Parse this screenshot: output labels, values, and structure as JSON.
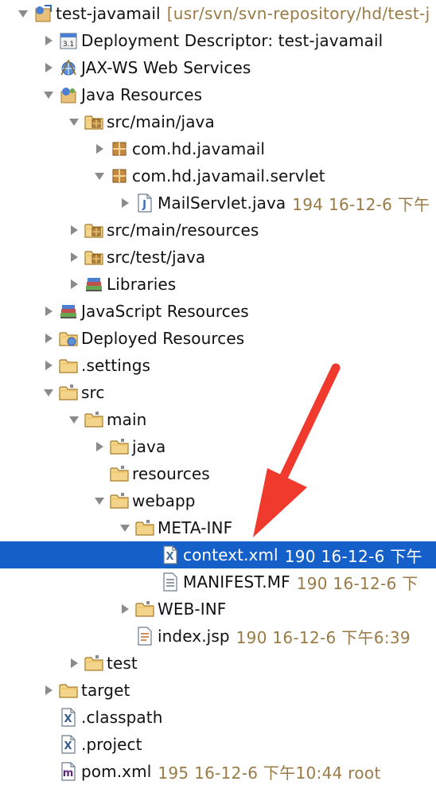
{
  "selected_color": "#1560c8",
  "decoration_color": "#9a7a45",
  "annotation_color": "#f03a2e",
  "tree": [
    {
      "label": "test-javamail",
      "deco": "[usr/svn/svn-repository/hd/test-j",
      "depth": 0,
      "toggle": "expanded",
      "icon": "project-icon"
    },
    {
      "label": "Deployment Descriptor: test-javamail",
      "depth": 1,
      "toggle": "collapsed",
      "icon": "deployment-descriptor-icon"
    },
    {
      "label": "JAX-WS Web Services",
      "depth": 1,
      "toggle": "collapsed",
      "icon": "web-services-icon"
    },
    {
      "label": "Java Resources",
      "depth": 1,
      "toggle": "expanded",
      "icon": "java-resources-icon"
    },
    {
      "label": "src/main/java",
      "depth": 2,
      "toggle": "expanded",
      "icon": "source-folder-icon"
    },
    {
      "label": "com.hd.javamail",
      "depth": 3,
      "toggle": "collapsed",
      "icon": "package-icon"
    },
    {
      "label": "com.hd.javamail.servlet",
      "depth": 3,
      "toggle": "expanded",
      "icon": "package-icon"
    },
    {
      "label": "MailServlet.java",
      "deco": "194  16-12-6 下午",
      "depth": 4,
      "toggle": "collapsed",
      "icon": "java-file-icon"
    },
    {
      "label": "src/main/resources",
      "depth": 2,
      "toggle": "collapsed",
      "icon": "source-folder-icon"
    },
    {
      "label": "src/test/java",
      "depth": 2,
      "toggle": "collapsed",
      "icon": "source-folder-icon"
    },
    {
      "label": "Libraries",
      "depth": 2,
      "toggle": "collapsed",
      "icon": "libraries-icon"
    },
    {
      "label": "JavaScript Resources",
      "depth": 1,
      "toggle": "collapsed",
      "icon": "libraries-icon"
    },
    {
      "label": "Deployed Resources",
      "depth": 1,
      "toggle": "collapsed",
      "icon": "deployed-folder-icon"
    },
    {
      "label": ".settings",
      "depth": 1,
      "toggle": "collapsed",
      "icon": "folder-icon"
    },
    {
      "label": "src",
      "depth": 1,
      "toggle": "expanded",
      "icon": "svn-folder-icon"
    },
    {
      "label": "main",
      "depth": 2,
      "toggle": "expanded",
      "icon": "svn-folder-icon"
    },
    {
      "label": "java",
      "depth": 3,
      "toggle": "collapsed",
      "icon": "svn-folder-icon"
    },
    {
      "label": "resources",
      "depth": 3,
      "toggle": "none",
      "icon": "svn-folder-icon"
    },
    {
      "label": "webapp",
      "depth": 3,
      "toggle": "expanded",
      "icon": "svn-folder-icon"
    },
    {
      "label": "META-INF",
      "depth": 4,
      "toggle": "expanded",
      "icon": "svn-folder-icon"
    },
    {
      "label": "context.xml",
      "deco": "190  16-12-6 下午",
      "depth": 5,
      "toggle": "none",
      "icon": "xml-file-icon",
      "selected": true
    },
    {
      "label": "MANIFEST.MF",
      "deco": "190  16-12-6 下",
      "depth": 5,
      "toggle": "none",
      "icon": "text-file-icon"
    },
    {
      "label": "WEB-INF",
      "depth": 4,
      "toggle": "collapsed",
      "icon": "svn-folder-icon"
    },
    {
      "label": "index.jsp",
      "deco": "190  16-12-6 下午6:39",
      "depth": 4,
      "toggle": "none",
      "icon": "jsp-file-icon"
    },
    {
      "label": "test",
      "depth": 2,
      "toggle": "collapsed",
      "icon": "svn-folder-icon"
    },
    {
      "label": "target",
      "depth": 1,
      "toggle": "collapsed",
      "icon": "folder-icon"
    },
    {
      "label": ".classpath",
      "depth": 1,
      "toggle": "none",
      "icon": "x-file-icon"
    },
    {
      "label": ".project",
      "depth": 1,
      "toggle": "none",
      "icon": "x-file-icon"
    },
    {
      "label": "pom.xml",
      "deco": "195  16-12-6 下午10:44  root",
      "depth": 1,
      "toggle": "none",
      "icon": "maven-file-icon"
    }
  ]
}
